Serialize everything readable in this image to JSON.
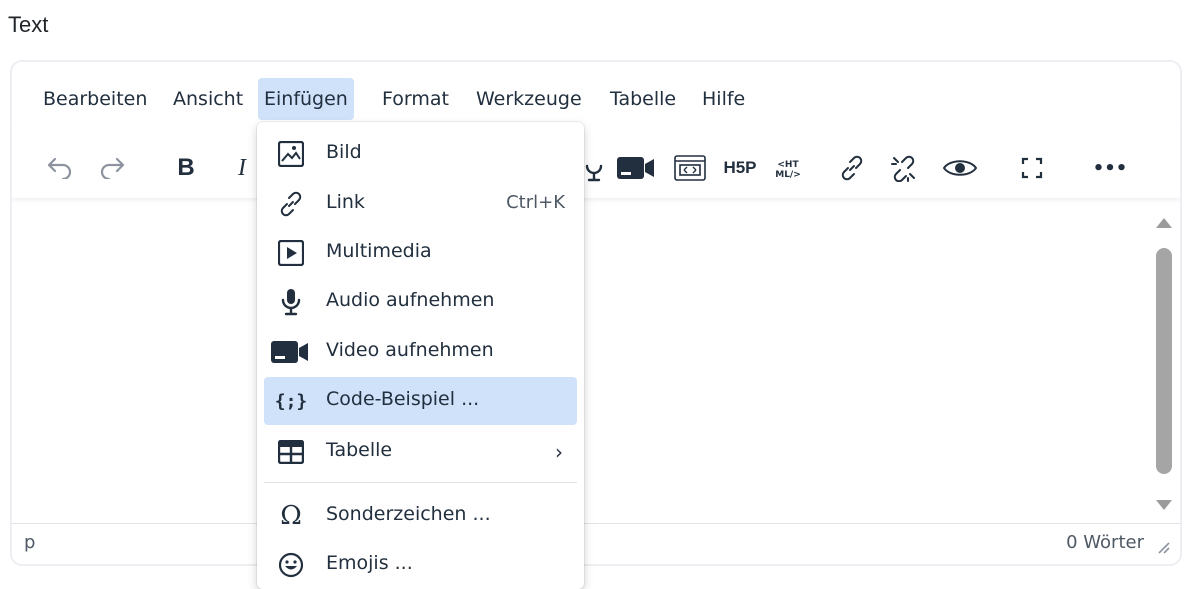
{
  "field_label": "Text",
  "menubar": {
    "items": [
      {
        "label": "Bearbeiten"
      },
      {
        "label": "Ansicht"
      },
      {
        "label": "Einfügen",
        "active": true
      },
      {
        "label": "Format"
      },
      {
        "label": "Werkzeuge"
      },
      {
        "label": "Tabelle"
      },
      {
        "label": "Hilfe"
      }
    ]
  },
  "toolbar": {
    "buttons": [
      "undo-icon",
      "redo-icon",
      "bold-icon",
      "italic-icon",
      "audio-icon",
      "video-icon",
      "embed-icon",
      "h5p-icon",
      "html-icon",
      "link-icon",
      "unlink-icon",
      "preview-icon",
      "fullscreen-icon",
      "more-icon"
    ],
    "bold_label": "B",
    "italic_label": "I",
    "h5p_label": "H5P",
    "more_label": "•••"
  },
  "dropdown": {
    "items": [
      {
        "label": "Bild",
        "icon": "image-icon"
      },
      {
        "label": "Link",
        "icon": "link-icon",
        "shortcut": "Ctrl+K"
      },
      {
        "label": "Multimedia",
        "icon": "multimedia-icon"
      },
      {
        "label": "Audio aufnehmen",
        "icon": "microphone-icon"
      },
      {
        "label": "Video aufnehmen",
        "icon": "video-camera-icon"
      },
      {
        "label": "Code-Beispiel ...",
        "icon": "code-sample-icon",
        "highlighted": true
      },
      {
        "label": "Tabelle",
        "icon": "table-icon",
        "submenu": true
      },
      {
        "label": "Sonderzeichen ...",
        "icon": "omega-icon"
      },
      {
        "label": "Emojis ...",
        "icon": "emoji-icon"
      }
    ],
    "code_icon_text": "{;}",
    "omega_text": "Ω",
    "chevron_text": "›"
  },
  "statusbar": {
    "path": "p",
    "word_count": "0 Wörter"
  },
  "colors": {
    "accent_highlight": "#cfe2fa",
    "text": "#222f3e",
    "muted_icon": "#8d94a0"
  }
}
